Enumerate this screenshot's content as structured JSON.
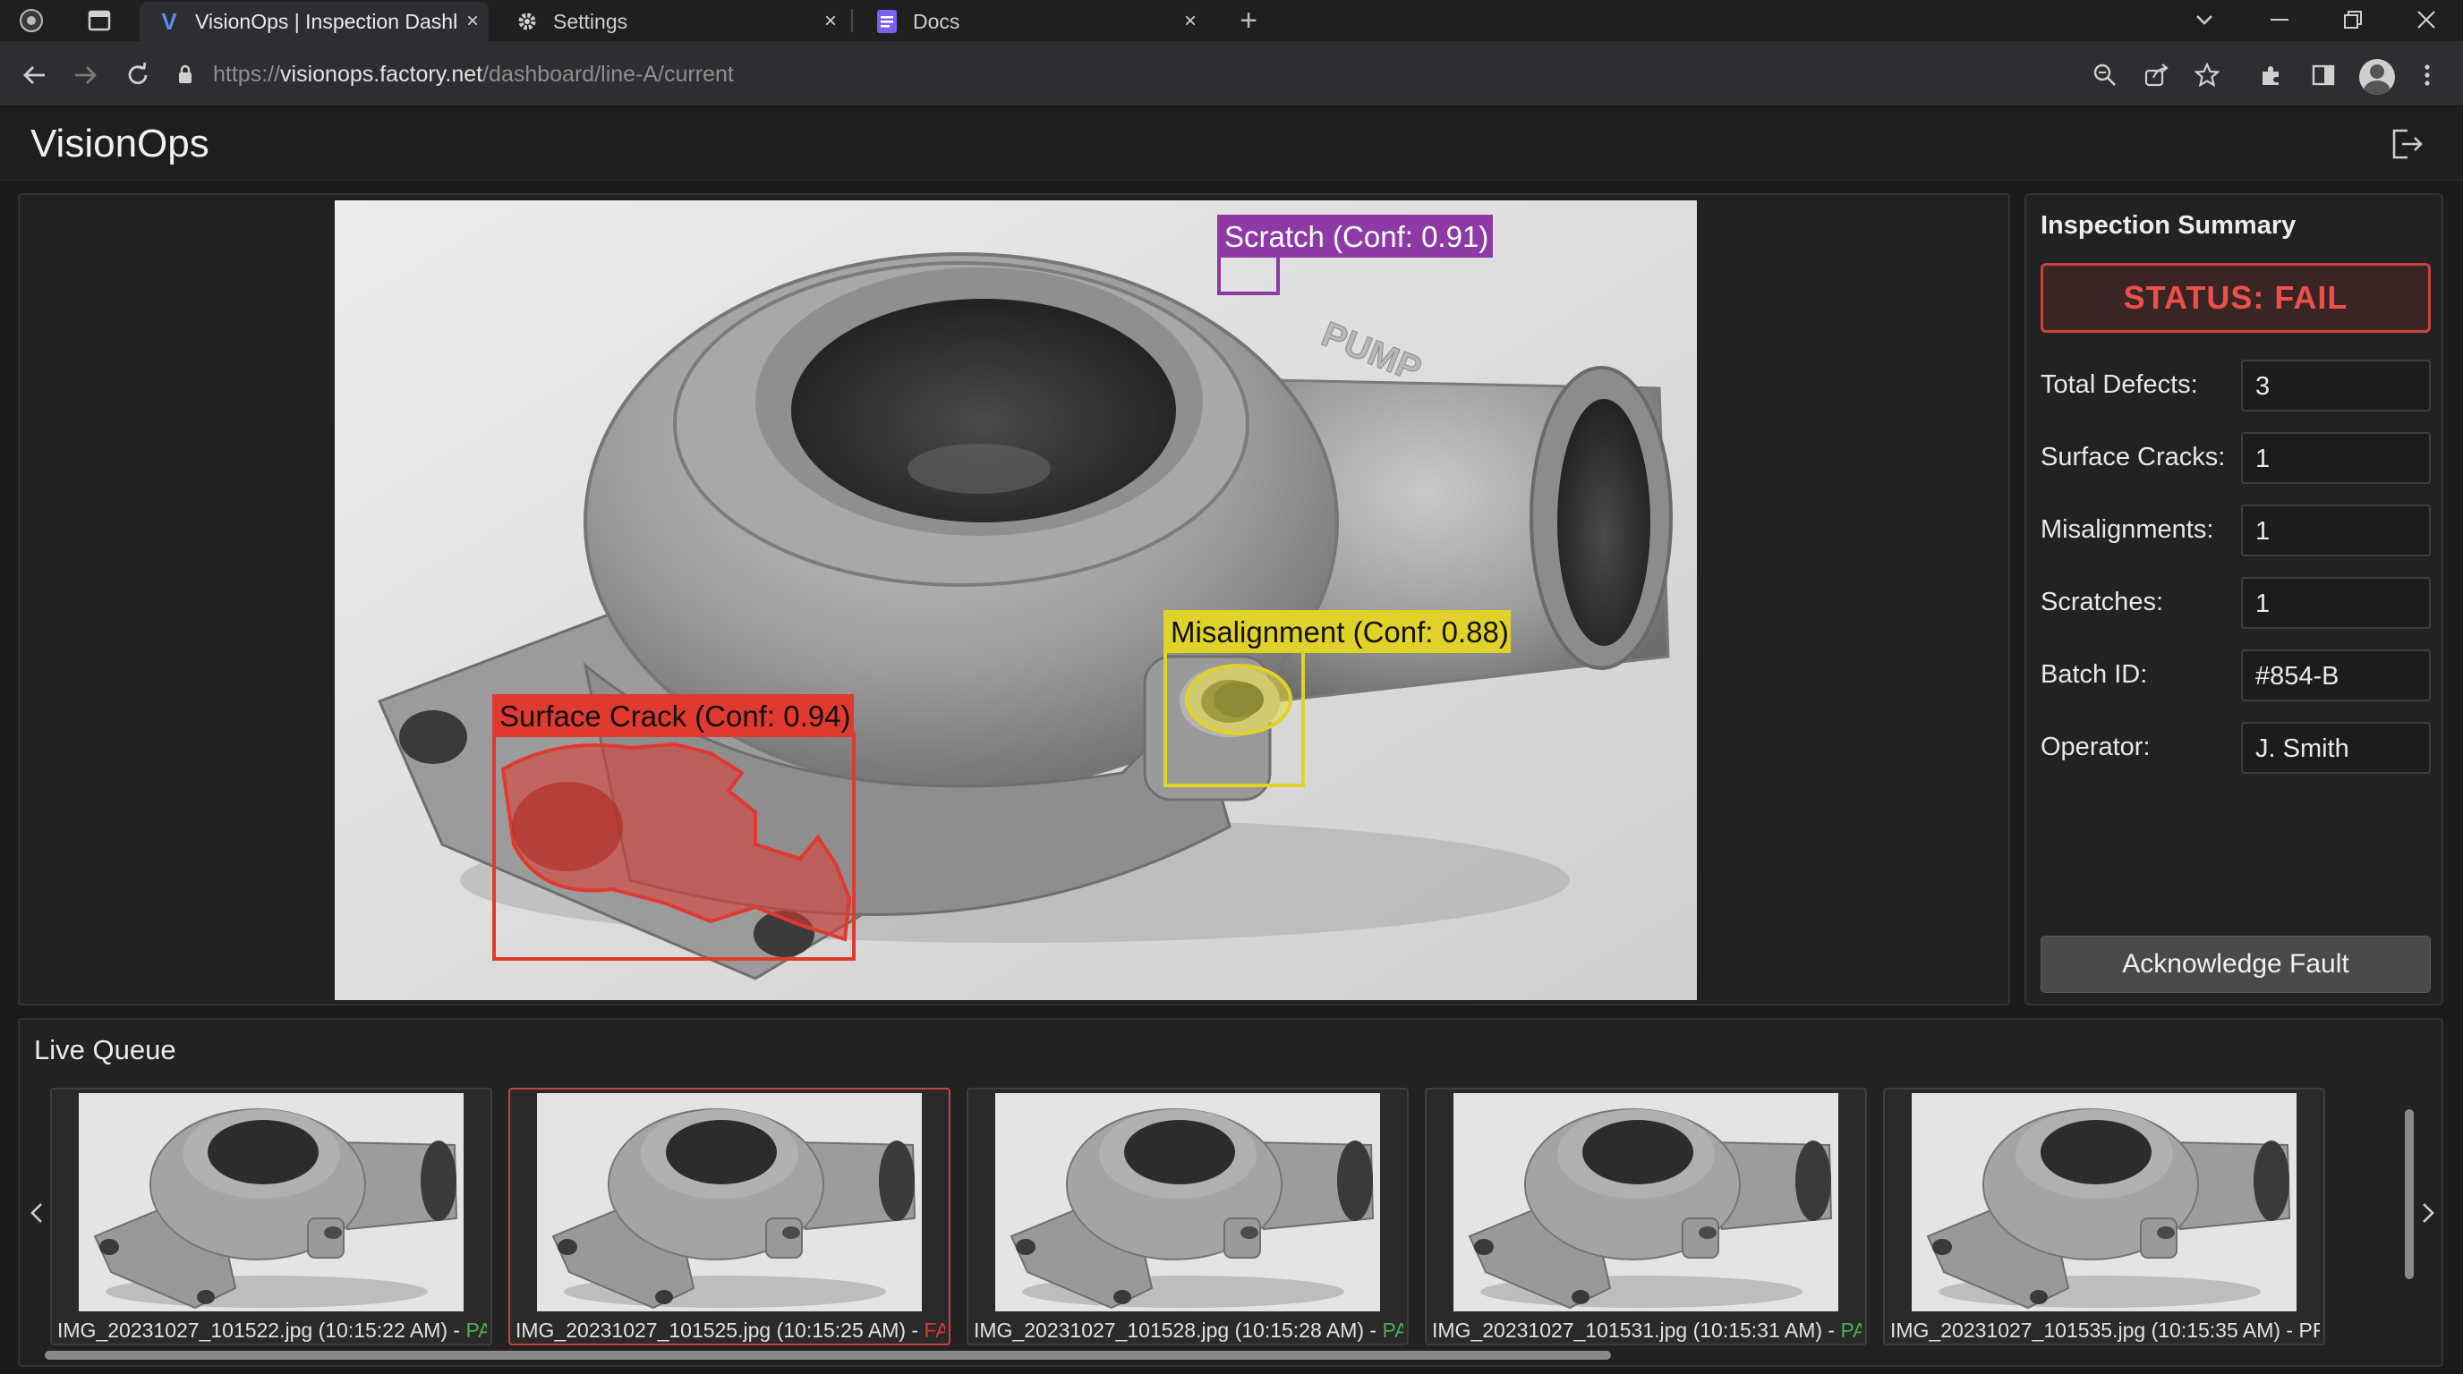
{
  "browser": {
    "tabs": [
      {
        "label": "VisionOps | Inspection Dashboard",
        "icon": "visionops-logo-icon",
        "active": true
      },
      {
        "label": "Settings",
        "icon": "gear-icon",
        "active": false
      },
      {
        "label": "Docs",
        "icon": "docs-icon",
        "active": false
      }
    ],
    "close_glyph": "×",
    "new_tab_glyph": "+",
    "url_scheme": "https://",
    "url_host": "visionops.factory.net",
    "url_path": "/dashboard/line-A/current"
  },
  "app": {
    "title": "VisionOps"
  },
  "inspection": {
    "defects": [
      {
        "label": "Scratch (Conf: 0.91)",
        "color": "#8e3aa6"
      },
      {
        "label": "Misalignment (Conf: 0.88)",
        "color": "#e0d229"
      },
      {
        "label": "Surface Crack (Conf: 0.94)",
        "color": "#e0392f"
      }
    ],
    "part_marking": "PUMP"
  },
  "summary": {
    "title": "Inspection Summary",
    "status": "STATUS: FAIL",
    "status_color": "#ef4e4a",
    "rows": [
      {
        "label": "Total Defects:",
        "value": "3"
      },
      {
        "label": "Surface Cracks:",
        "value": "1"
      },
      {
        "label": "Misalignments:",
        "value": "1"
      },
      {
        "label": "Scratches:",
        "value": "1"
      },
      {
        "label": "Batch ID:",
        "value": "#854-B"
      },
      {
        "label": "Operator:",
        "value": "J. Smith"
      }
    ],
    "ack_label": "Acknowledge Fault"
  },
  "queue": {
    "title": "Live Queue",
    "items": [
      {
        "file": "IMG_20231027_101522.jpg (10:15:22 AM)",
        "status": "PASS",
        "status_color": "#4caf50",
        "selected": false
      },
      {
        "file": "IMG_20231027_101525.jpg (10:15:25 AM)",
        "status": "FAIL",
        "status_color": "#e0392f",
        "selected": true
      },
      {
        "file": "IMG_20231027_101528.jpg (10:15:28 AM)",
        "status": "PASS",
        "status_color": "#4caf50",
        "selected": false
      },
      {
        "file": "IMG_20231027_101531.jpg (10:15:31 AM)",
        "status": "PASS",
        "status_color": "#4caf50",
        "selected": false
      },
      {
        "file": "IMG_20231027_101535.jpg (10:15:35 AM)",
        "status": "PROCESSING",
        "status_color": "#e2e2e2",
        "selected": false
      }
    ],
    "separator": " - "
  }
}
